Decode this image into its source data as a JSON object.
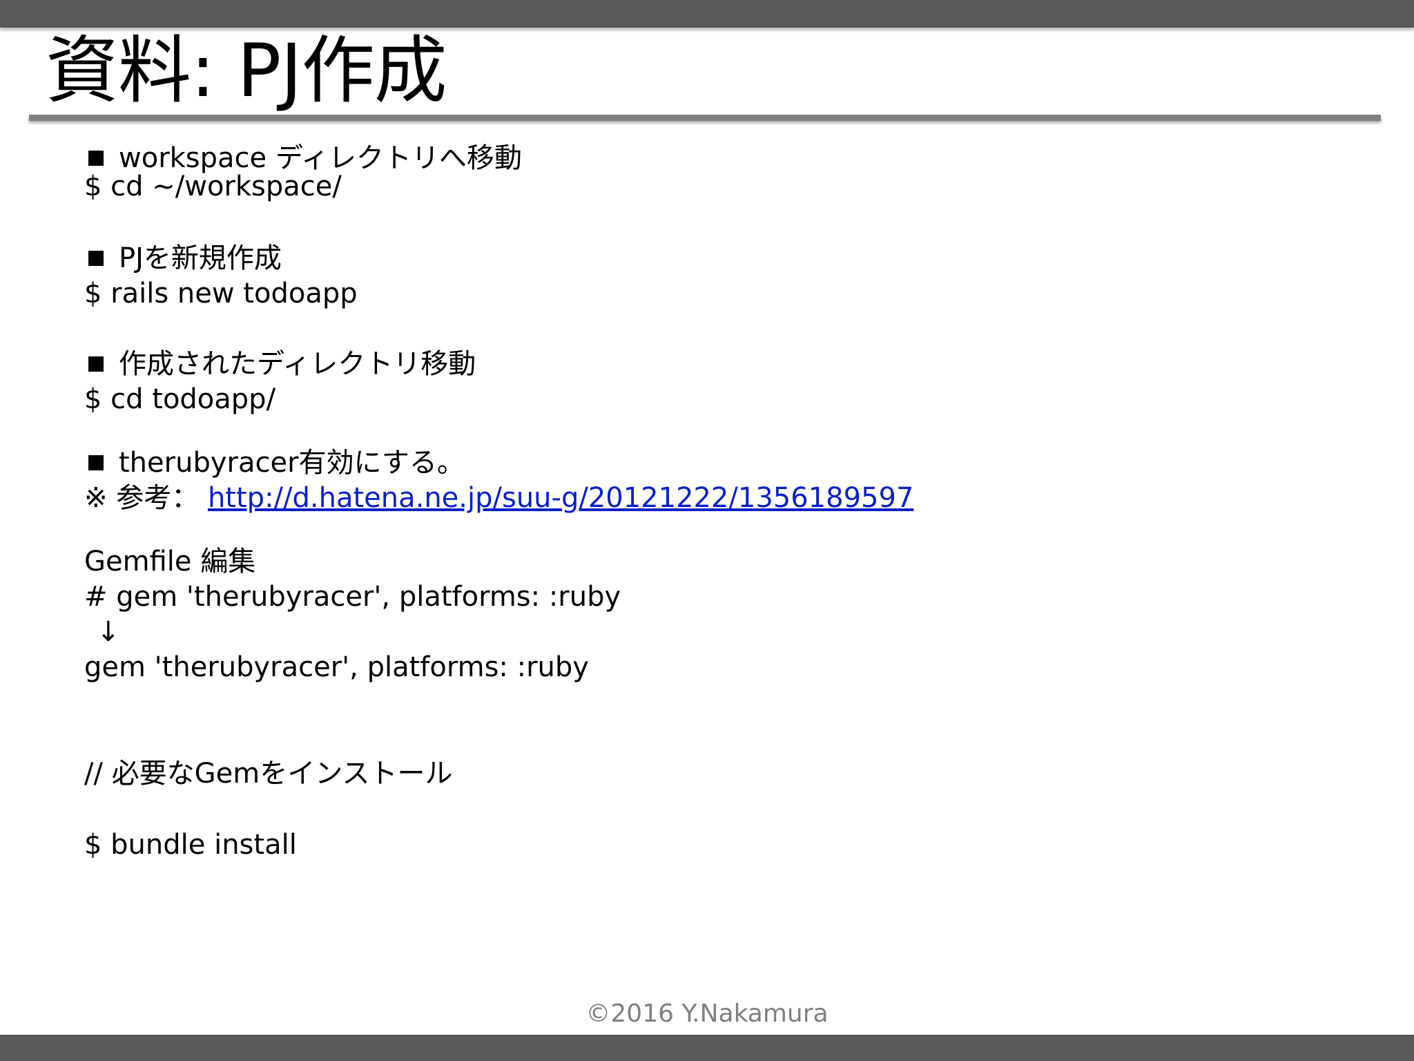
{
  "slide": {
    "title": "資料: PJ作成",
    "footer": "©2016 Y.Nakamura"
  },
  "sections": {
    "s1": {
      "heading": "workspace ディレクトリへ移動",
      "command": "$ cd ~/workspace/"
    },
    "s2": {
      "heading": "PJを新規作成",
      "command": "$ rails new todoapp"
    },
    "s3": {
      "heading": "作成されたディレクトリ移動",
      "command": "$ cd todoapp/"
    },
    "s4": {
      "heading": "therubyracer有効にする。",
      "ref_prefix": "※ 参考：",
      "ref_link": "http://d.hatena.ne.jp/suu-g/20121222/1356189597",
      "gemfile_label": "Gemfile 編集",
      "before": "# gem 'therubyracer',  platforms: :ruby",
      "arrow": "↓",
      "after": "gem 'therubyracer',  platforms: :ruby"
    },
    "s5": {
      "comment": "// 必要なGemをインストール",
      "command": "$ bundle install"
    }
  },
  "colors": {
    "bar": "#595959",
    "rule": "#808080",
    "link": "#0b20c8",
    "footer_text": "#7f7f7f"
  }
}
